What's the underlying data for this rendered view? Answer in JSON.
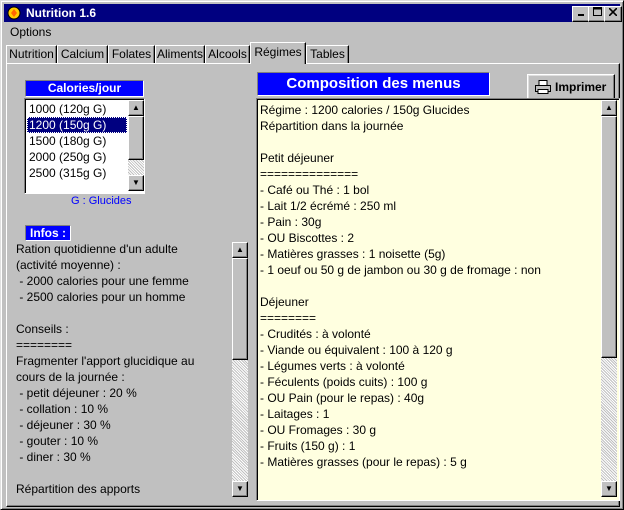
{
  "window": {
    "title": "Nutrition 1.6"
  },
  "menu": {
    "items": [
      "Options"
    ]
  },
  "tabs": [
    "Nutrition",
    "Calcium",
    "Folates",
    "Aliments",
    "Alcools",
    "Régimes",
    "Tables"
  ],
  "active_tab": "Régimes",
  "calories": {
    "label": "Calories/jour",
    "options": [
      "1000 (120g G)",
      "1200 (150g G)",
      "1500 (180g G)",
      "2000 (250g G)",
      "2500 (315g G)"
    ],
    "selected": "1200 (150g G)",
    "caption": "G : Glucides"
  },
  "infos": {
    "label": "Infos :",
    "lines": [
      "Ration quotidienne d'un adulte",
      "(activité moyenne) :",
      " - 2000 calories pour une femme",
      " - 2500 calories pour un homme",
      "",
      "Conseils :",
      "========",
      "Fragmenter l'apport glucidique au",
      "cours de la journée :",
      " - petit déjeuner : 20 %",
      " - collation : 10 %",
      " - déjeuner : 30 %",
      " - gouter : 10 %",
      " - diner : 30 %",
      "",
      "Répartition des apports"
    ]
  },
  "menus": {
    "title": "Composition des menus",
    "print_label": "Imprimer",
    "lines": [
      "Régime : 1200 calories / 150g Glucides",
      "Répartition dans la journée",
      "",
      "Petit déjeuner",
      "==============",
      "- Café ou Thé : 1 bol",
      "- Lait 1/2 écrémé : 250 ml",
      "- Pain : 30g",
      "- OU Biscottes : 2",
      "- Matières grasses : 1 noisette (5g)",
      "- 1 oeuf ou 50 g de jambon ou 30 g de fromage : non",
      "",
      "Déjeuner",
      "========",
      "- Crudités : à volonté",
      "- Viande ou équivalent : 100 à 120 g",
      "- Légumes verts : à volonté",
      "- Féculents (poids cuits) : 100 g",
      "- OU Pain (pour le repas) : 40g",
      "- Laitages : 1",
      "- OU Fromages : 30 g",
      "- Fruits (150 g) : 1",
      "- Matières grasses (pour le repas) : 5 g"
    ]
  }
}
